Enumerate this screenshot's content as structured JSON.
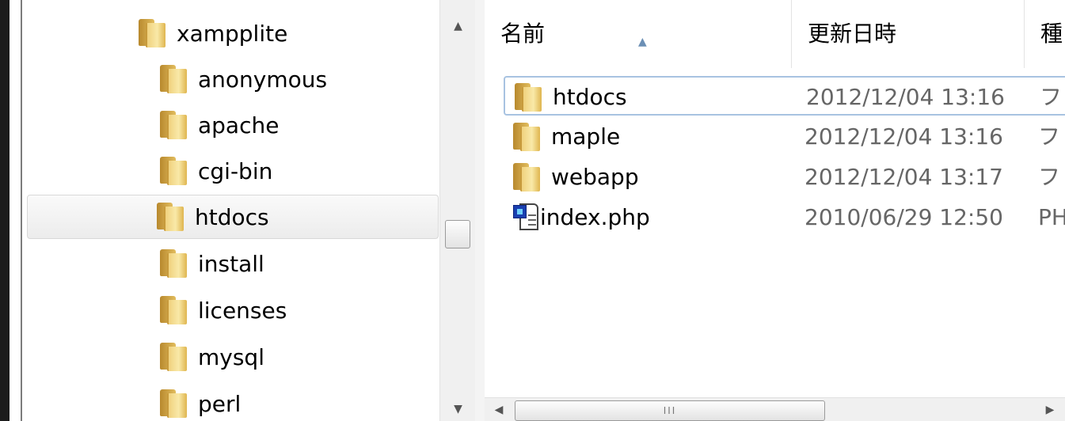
{
  "nav_pane": {
    "parent": {
      "label": "xampplite"
    },
    "items": [
      {
        "label": "anonymous",
        "selected": false
      },
      {
        "label": "apache",
        "selected": false
      },
      {
        "label": "cgi-bin",
        "selected": false
      },
      {
        "label": "htdocs",
        "selected": true
      },
      {
        "label": "install",
        "selected": false
      },
      {
        "label": "licenses",
        "selected": false
      },
      {
        "label": "mysql",
        "selected": false
      },
      {
        "label": "perl",
        "selected": false
      }
    ]
  },
  "file_list": {
    "columns": [
      {
        "label": "名前",
        "sorted": "ascending"
      },
      {
        "label": "更新日時"
      },
      {
        "label": "種"
      }
    ],
    "rows": [
      {
        "name": "htdocs",
        "modified": "2012/12/04 13:16",
        "type": "フ",
        "icon": "folder-icon",
        "focused": true
      },
      {
        "name": "maple",
        "modified": "2012/12/04 13:16",
        "type": "フ",
        "icon": "folder-icon",
        "focused": false
      },
      {
        "name": "webapp",
        "modified": "2012/12/04 13:17",
        "type": "フ",
        "icon": "folder-icon",
        "focused": false
      },
      {
        "name": "index.php",
        "modified": "2010/06/29 12:50",
        "type": "PH",
        "icon": "php-file-icon",
        "focused": false
      }
    ]
  },
  "scrollbars": {
    "vertical": {
      "up_glyph": "▲",
      "down_glyph": "▼"
    },
    "horizontal": {
      "left_glyph": "◀",
      "right_glyph": "▶",
      "thumb_grip": "III"
    }
  },
  "colors": {
    "selection_border": "#a8c3e1",
    "folder_yellow": "#f0d17e"
  }
}
